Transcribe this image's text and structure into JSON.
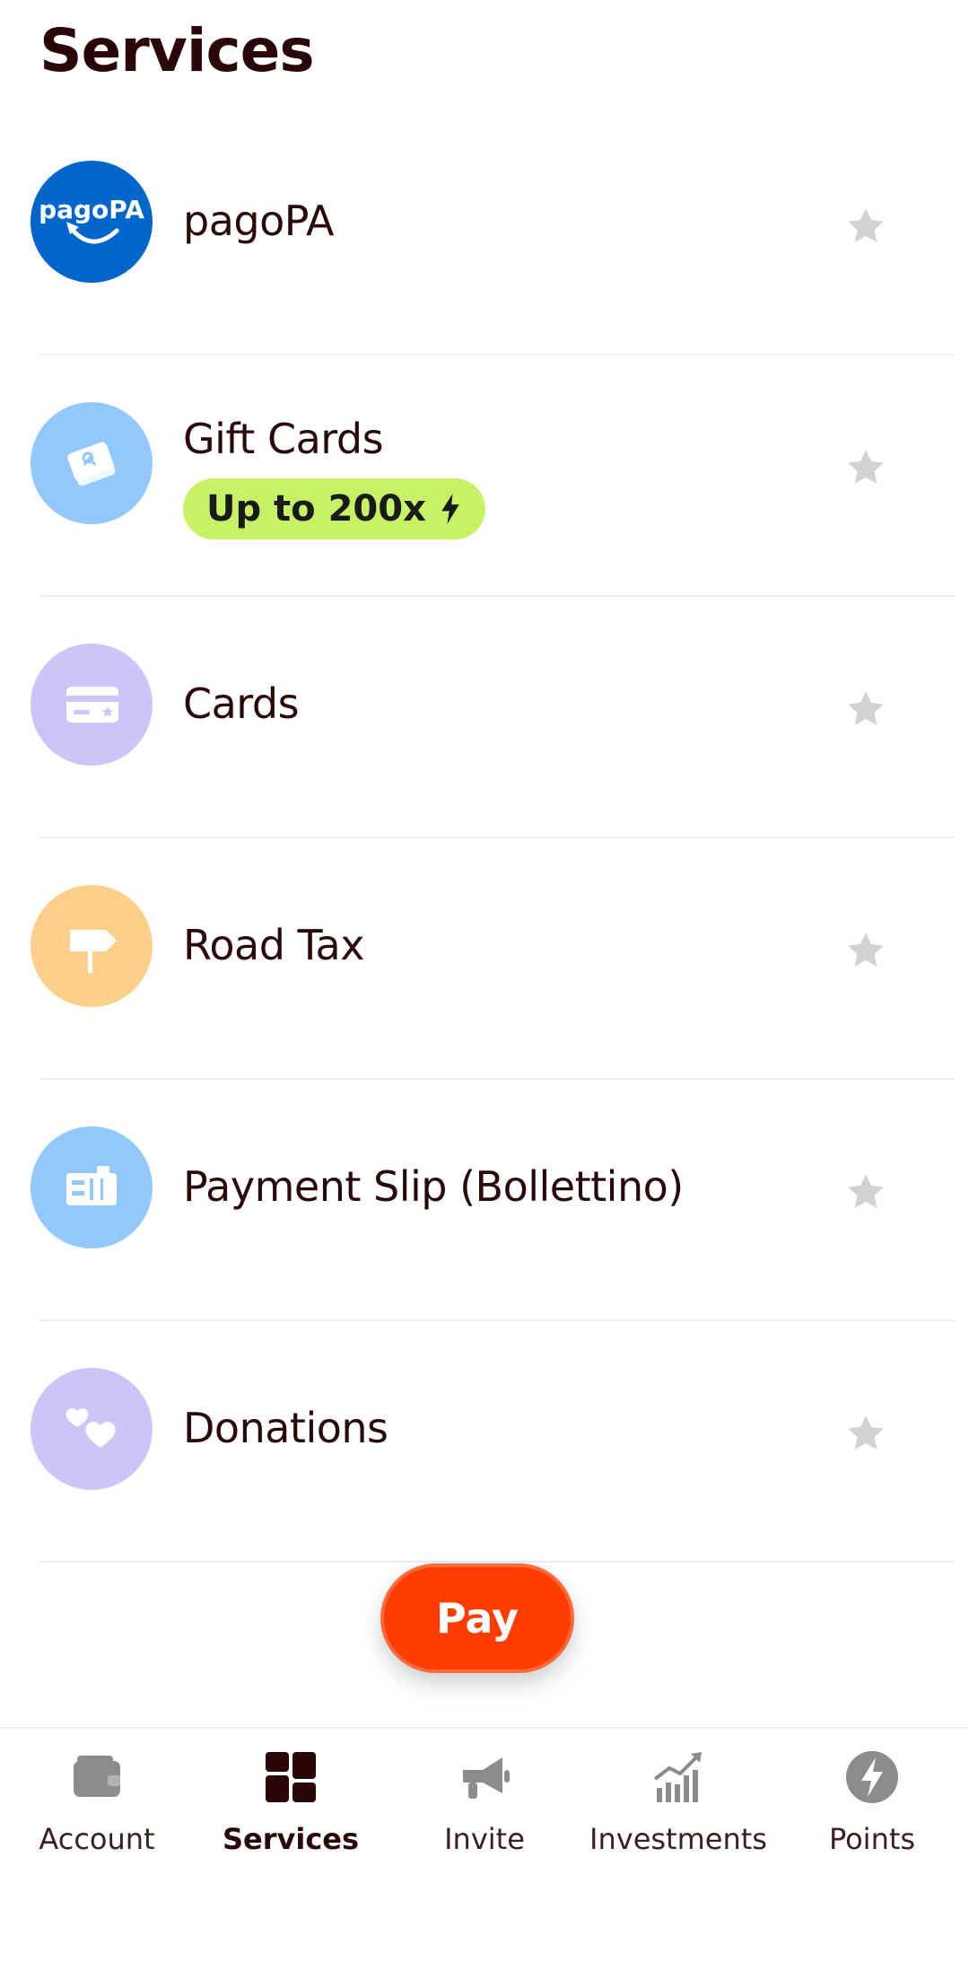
{
  "header": {
    "title": "Services"
  },
  "services": [
    {
      "label": "pagoPA",
      "icon": "pagopa-logo-icon",
      "bg": "#0066cc",
      "logo_text": "pagoPA"
    },
    {
      "label": "Gift Cards",
      "icon": "gift-card-icon",
      "bg": "#92c8fc",
      "badge": "Up to 200x"
    },
    {
      "label": "Cards",
      "icon": "card-icon",
      "bg": "#cdc4f8"
    },
    {
      "label": "Road Tax",
      "icon": "signpost-icon",
      "bg": "#fdd089"
    },
    {
      "label": "Payment Slip (Bollettino)",
      "icon": "payment-slip-icon",
      "bg": "#92c8fc"
    },
    {
      "label": "Donations",
      "icon": "hearts-icon",
      "bg": "#cdc4f8"
    }
  ],
  "pay_button": {
    "label": "Pay",
    "color": "#ff3d00"
  },
  "nav": [
    {
      "label": "Account",
      "icon": "wallet-icon"
    },
    {
      "label": "Services",
      "icon": "grid-icon",
      "active": true
    },
    {
      "label": "Invite",
      "icon": "megaphone-icon"
    },
    {
      "label": "Investments",
      "icon": "chart-icon"
    },
    {
      "label": "Points",
      "icon": "lightning-icon"
    }
  ],
  "colors": {
    "star": "#d2d2d2",
    "badge_bg": "#c8f266",
    "nav_icon": "#8c8c8c",
    "nav_active": "#2b0606"
  }
}
